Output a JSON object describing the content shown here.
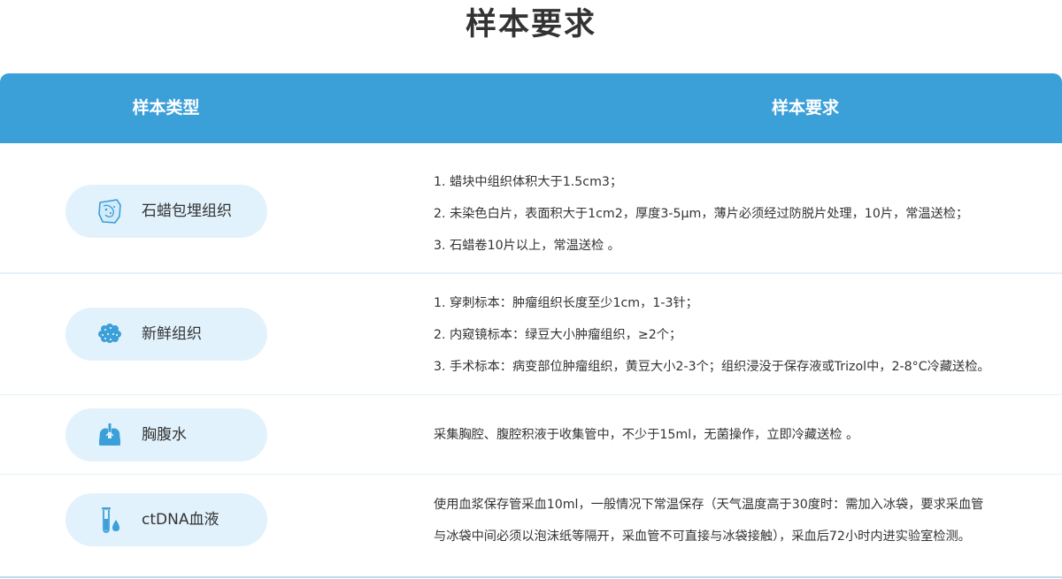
{
  "page": {
    "title": "样本要求"
  },
  "table": {
    "header": {
      "type_label": "样本类型",
      "requirement_label": "样本要求"
    },
    "rows": [
      {
        "name": "石蜡包埋组织",
        "icon": "paraffin-tissue-icon",
        "requirements": [
          "1. 蜡块中组织体积大于1.5cm3；",
          "2. 未染色白片，表面积大于1cm2，厚度3-5μm，薄片必须经过防脱片处理，10片，常温送检；",
          "3. 石蜡卷10片以上，常温送检 。"
        ]
      },
      {
        "name": "新鲜组织",
        "icon": "fresh-tissue-icon",
        "requirements": [
          "1. 穿刺标本：肿瘤组织长度至少1cm，1-3针；",
          "2. 内窥镜标本：绿豆大小肿瘤组织，≥2个；",
          "3. 手术标本：病变部位肿瘤组织，黄豆大小2-3个；组织浸没于保存液或Trizol中，2-8°C冷藏送检。"
        ]
      },
      {
        "name": "胸腹水",
        "icon": "lungs-icon",
        "requirements": [
          "采集胸腔、腹腔积液于收集管中，不少于15ml，无菌操作，立即冷藏送检 。"
        ]
      },
      {
        "name": "ctDNA血液",
        "icon": "blood-tube-icon",
        "requirements": [
          "使用血浆保存管采血10ml，一般情况下常温保存（天气温度高于30度时：需加入冰袋，要求采血管",
          "与冰袋中间必须以泡沫纸等隔开，采血管不可直接与冰袋接触），采血后72小时内进实验室检测。"
        ]
      }
    ]
  },
  "colors": {
    "header_bg": "#3b9fd8",
    "pill_bg": "#e2f2fc",
    "icon_blue": "#3b9fd8"
  }
}
